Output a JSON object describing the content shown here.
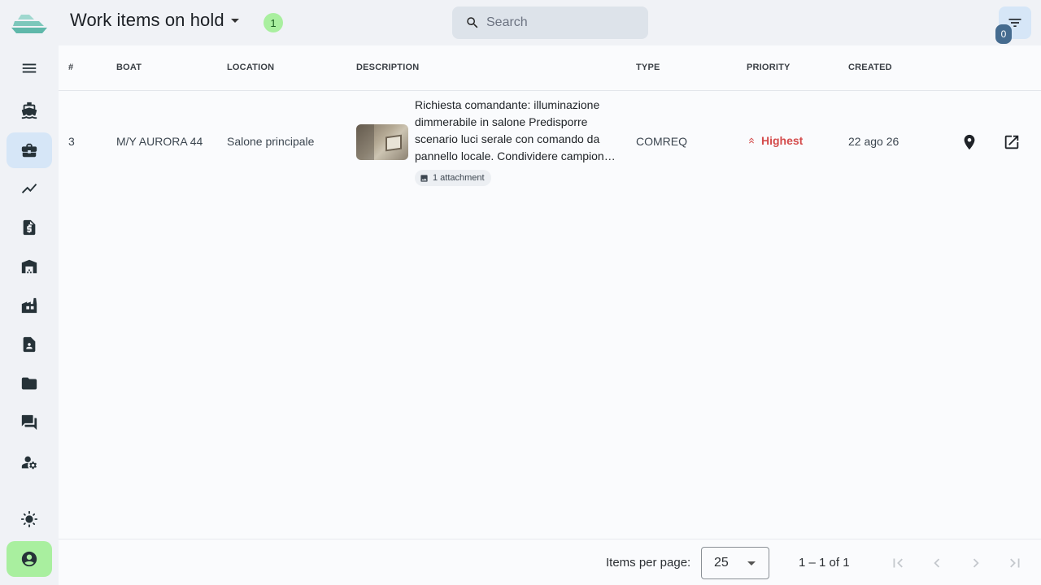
{
  "header": {
    "title": "Work items on hold",
    "count_badge": "1",
    "search_placeholder": "Search",
    "filter_count": "0"
  },
  "sidebar": {
    "items": [
      {
        "name": "menu-icon"
      },
      {
        "name": "boat-icon"
      },
      {
        "name": "briefcase-icon",
        "active": true
      },
      {
        "name": "trending-icon"
      },
      {
        "name": "invoice-icon"
      },
      {
        "name": "warehouse-icon"
      },
      {
        "name": "factory-icon"
      },
      {
        "name": "contact-document-icon"
      },
      {
        "name": "folder-icon"
      },
      {
        "name": "forum-icon"
      },
      {
        "name": "user-settings-icon"
      },
      {
        "name": "brightness-icon"
      },
      {
        "name": "account-circle-icon"
      }
    ]
  },
  "table": {
    "columns": [
      "#",
      "BOAT",
      "LOCATION",
      "DESCRIPTION",
      "TYPE",
      "PRIORITY",
      "CREATED"
    ],
    "rows": [
      {
        "id": "3",
        "boat": "M/Y AURORA 44",
        "location": "Salone principale",
        "description": "Richiesta comandante: illuminazione dimmerabile in salone Predisporre scenario luci serale con comando da pannello locale. Condividere campion…",
        "attachments": "1 attachment",
        "type": "COMREQ",
        "priority": "Highest",
        "created": "22 ago 26"
      }
    ]
  },
  "paginator": {
    "items_per_page_label": "Items per page:",
    "items_per_page_value": "25",
    "range_label": "1 – 1 of 1"
  },
  "colors": {
    "accent_active": "#d6e6f7",
    "badge_green": "#a9ef9f",
    "priority_red": "#d44b4b",
    "filter_badge": "#456b8f"
  }
}
